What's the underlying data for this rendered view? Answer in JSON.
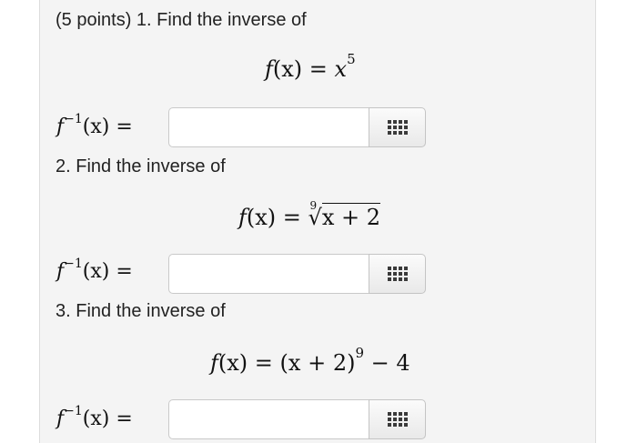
{
  "q1": {
    "intro": "(5 points) 1. Find the inverse of",
    "lhs": "f",
    "arg": "(x)",
    "eq": "=",
    "base": "x",
    "exp": "5"
  },
  "q2": {
    "intro": "2. Find the inverse of",
    "lhs": "f",
    "arg": "(x)",
    "eq": "=",
    "root_index": "9",
    "radical": "√",
    "radicand": "x + 2"
  },
  "q3": {
    "intro": "3. Find the inverse of",
    "lhs": "f",
    "arg": "(x)",
    "eq": "=",
    "group": "(x + 2)",
    "exp": "9",
    "tail": "− 4"
  },
  "inverse_label": {
    "f": "f",
    "sup": "−1",
    "rest": "(x) ="
  },
  "answers": [
    {
      "value": ""
    },
    {
      "value": ""
    },
    {
      "value": ""
    }
  ],
  "icons": {
    "editor": "grid-icon"
  }
}
